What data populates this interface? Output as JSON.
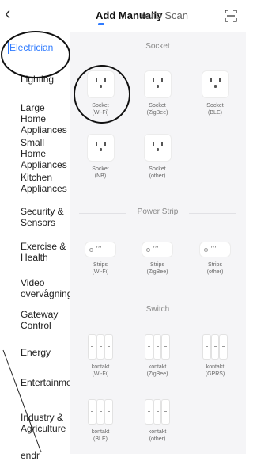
{
  "header": {
    "back_icon": "chevron-left-icon",
    "tabs": [
      {
        "label": "Add Manually",
        "active": true
      },
      {
        "label": "Auto Scan",
        "active": false
      }
    ],
    "scan_icon": "scan-frame-icon",
    "accent": "#2f7bff"
  },
  "sidebar": {
    "items": [
      {
        "label": "Electrician",
        "active": true
      },
      {
        "label": "Lighting"
      },
      {
        "label": "Large Home Appliances"
      },
      {
        "label": "Small Home Appliances"
      },
      {
        "label": "Kitchen Appliances"
      },
      {
        "label": "Security & Sensors"
      },
      {
        "label": "Exercise & Health"
      },
      {
        "label": "Video overvågning"
      },
      {
        "label": "Gateway Control"
      },
      {
        "label": "Energy"
      },
      {
        "label": "Entertainment"
      },
      {
        "label": "Industry & Agriculture"
      },
      {
        "label": "endr"
      }
    ]
  },
  "sections": [
    {
      "title": "Socket",
      "devices": [
        {
          "name": "Socket",
          "sub": "(Wi-Fi)"
        },
        {
          "name": "Socket",
          "sub": "(ZigBee)"
        },
        {
          "name": "Socket",
          "sub": "(BLE)"
        },
        {
          "name": "Socket",
          "sub": "(NB)"
        },
        {
          "name": "Socket",
          "sub": "(other)"
        }
      ]
    },
    {
      "title": "Power Strip",
      "devices": [
        {
          "name": "Strips",
          "sub": "(Wi-Fi)"
        },
        {
          "name": "Strips",
          "sub": "(ZigBee)"
        },
        {
          "name": "Strips",
          "sub": "(other)"
        }
      ]
    },
    {
      "title": "Switch",
      "devices": [
        {
          "name": "kontakt",
          "sub": "(Wi-Fi)"
        },
        {
          "name": "kontakt",
          "sub": "(ZigBee)"
        },
        {
          "name": "kontakt",
          "sub": "(GPRS)"
        },
        {
          "name": "kontakt",
          "sub": "(BLE)"
        },
        {
          "name": "kontakt",
          "sub": "(other)"
        }
      ]
    }
  ]
}
